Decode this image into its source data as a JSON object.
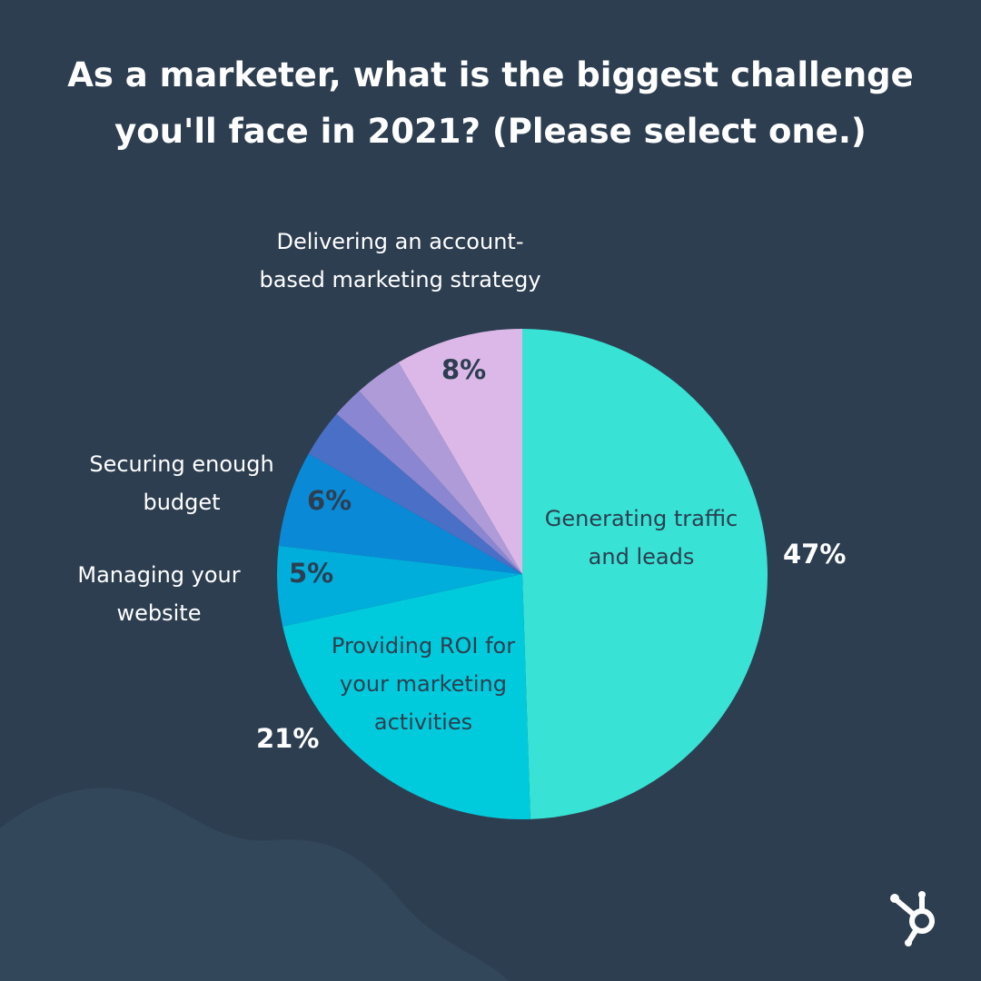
{
  "title": "As a marketer, what is the biggest challenge you'll face in 2021? (Please select one.)",
  "colors": {
    "background": "#2d3e50",
    "blob": "#324759",
    "text_light": "#ffffff",
    "text_dark": "#2d3e50"
  },
  "chart_data": {
    "type": "pie",
    "title": "As a marketer, what is the biggest challenge you'll face in 2021? (Please select one.)",
    "start": "12 o'clock, clockwise",
    "slices": [
      {
        "label": "Generating traffic and leads",
        "value": 47,
        "value_label": "47%",
        "color": "#38e2d5"
      },
      {
        "label": "Providing ROI for your marketing activities",
        "value": 21,
        "value_label": "21%",
        "color": "#00cbdc"
      },
      {
        "label": "Managing your website",
        "value": 5,
        "value_label": "5%",
        "color": "#00aedc"
      },
      {
        "label": "Securing enough budget",
        "value": 6,
        "value_label": "6%",
        "color": "#0a8ad6"
      },
      {
        "label": "",
        "value": 3,
        "value_label": "",
        "color": "#4a6fc6"
      },
      {
        "label": "",
        "value": 2,
        "value_label": "",
        "color": "#8a86d1"
      },
      {
        "label": "",
        "value": 3,
        "value_label": "",
        "color": "#ae9bd8"
      },
      {
        "label": "Delivering an account-based marketing strategy",
        "value": 8,
        "value_label": "8%",
        "color": "#dcb8e8"
      }
    ]
  },
  "labels": {
    "traffic": "Generating traffic and leads",
    "roi": "Providing ROI for your marketing activities",
    "website": "Managing your website",
    "budget": "Securing enough budget",
    "abm": "Delivering an account-based marketing strategy"
  },
  "percents": {
    "traffic": "47%",
    "roi": "21%",
    "website": "5%",
    "budget": "6%",
    "abm": "8%"
  },
  "logo": {
    "icon": "hubspot-sprocket-icon"
  }
}
